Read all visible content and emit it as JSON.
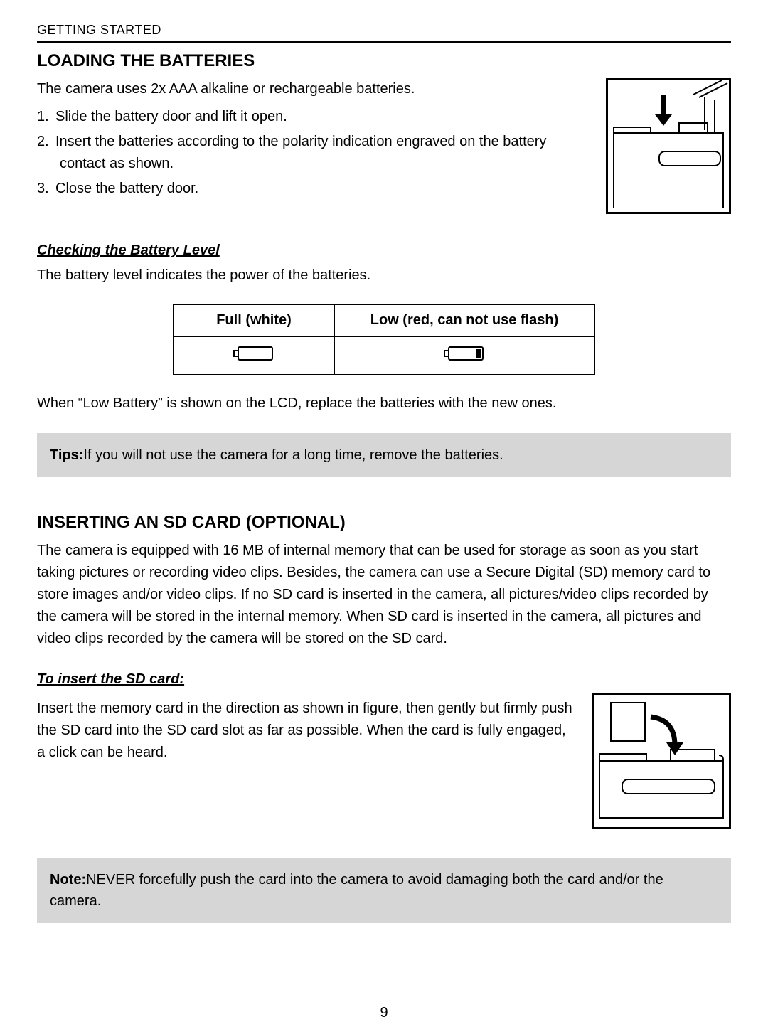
{
  "header": "GETTING STARTED",
  "section1": {
    "title": "LOADING THE BATTERIES",
    "intro": "The camera uses 2x AAA alkaline or rechargeable batteries.",
    "steps": [
      "Slide the battery door and lift it open.",
      "Insert the batteries according to the polarity indication engraved on the battery contact as shown.",
      "Close the battery door."
    ],
    "sub_heading": "Checking the Battery Level",
    "sub_text": "The battery level indicates the power of the batteries.",
    "table": {
      "col1": "Full (white)",
      "col2": "Low (red, can not use flash)"
    },
    "after_table": "When “Low Battery” is shown on the LCD,  replace the batteries with the new ones.",
    "tip_label": "Tips:",
    "tip_text": "If you will not use the camera for a long time, remove the batteries."
  },
  "section2": {
    "title": "INSERTING AN SD CARD (OPTIONAL)",
    "p1": "The camera is equipped with 16 MB of internal memory that can be used for storage as soon as you start taking pictures or recording video clips. Besides, the camera can use a Secure Digital (SD) memory card to store images and/or video clips. If no SD card is inserted in the camera, all pictures/video clips recorded by the camera will be stored in the internal memory. When SD card is inserted in the camera, all pictures and video clips recorded by the camera will be stored on the SD card.",
    "sub_heading": "To insert the SD card:",
    "p2": "Insert the memory card in the direction as shown in figure, then gently but firmly push the SD card into the SD card slot as far as possible. When the card is fully engaged, a click can be heard.",
    "note_label": "Note:",
    "note_text": "NEVER forcefully push the card into the camera to avoid damaging both the card and/or the camera."
  },
  "page_number": "9"
}
